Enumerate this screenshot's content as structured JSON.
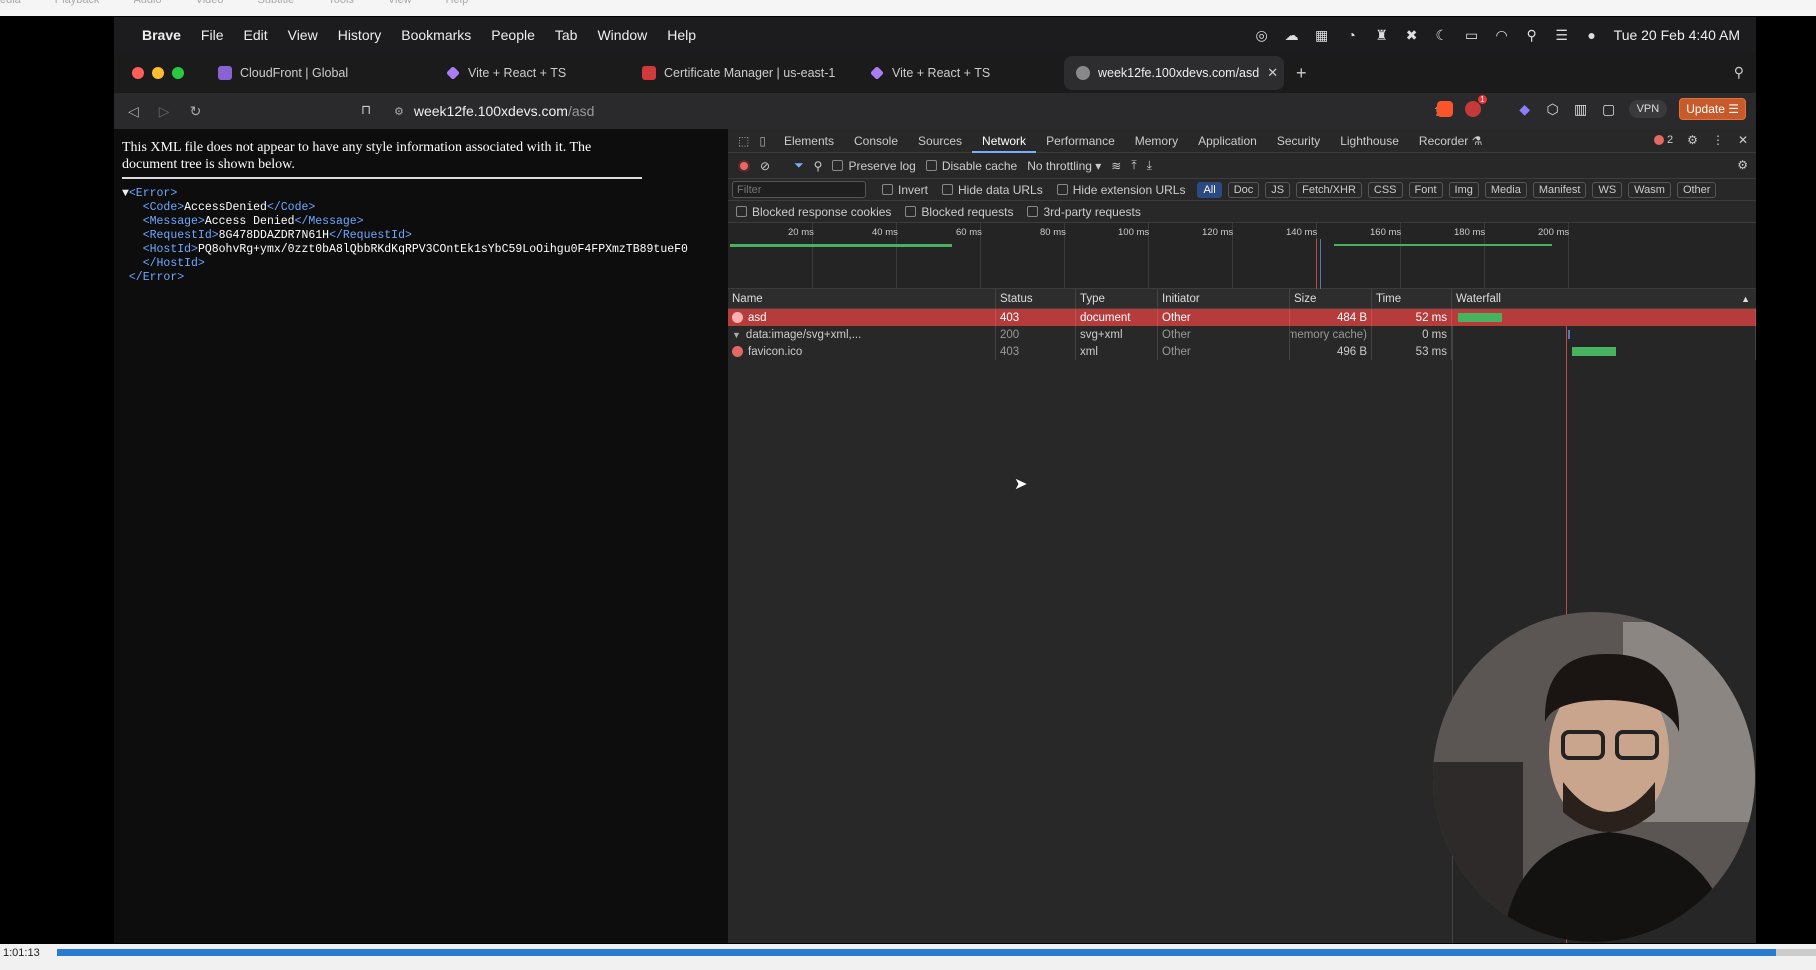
{
  "vlc_menu": [
    "edia",
    "Playback",
    "Audio",
    "Video",
    "Subtitle",
    "Tools",
    "View",
    "Help"
  ],
  "mac_menu": {
    "apple": "",
    "items": [
      "Brave",
      "File",
      "Edit",
      "View",
      "History",
      "Bookmarks",
      "People",
      "Tab",
      "Window",
      "Help"
    ],
    "clock": "Tue 20 Feb  4:40 AM"
  },
  "tabs": [
    {
      "title": "CloudFront | Global",
      "favicon_color": "#8a63d2"
    },
    {
      "title": "Vite + React + TS",
      "favicon_color": "#a97cf8"
    },
    {
      "title": "Certificate Manager | us-east-1",
      "favicon_color": "#d13a3a"
    },
    {
      "title": "Vite + React + TS",
      "favicon_color": "#a97cf8"
    },
    {
      "title": "week12fe.100xdevs.com/asd",
      "favicon_color": "#888888",
      "active": true
    }
  ],
  "toolbar": {
    "url_host": "week12fe.100xdevs.com",
    "url_path": "/asd",
    "vpn": "VPN",
    "update": "Update",
    "notif_count": "1"
  },
  "page": {
    "notice": "This XML file does not appear to have any style information associated with it. The document tree is shown below.",
    "xml": {
      "error_open": "<Error>",
      "error_close": "</Error>",
      "code_open": "<Code>",
      "code": "AccessDenied",
      "code_close": "</Code>",
      "msg_open": "<Message>",
      "message": "Access Denied",
      "msg_close": "</Message>",
      "req_open": "<RequestId>",
      "request_id": "8G478DDAZDR7N61H",
      "req_close": "</RequestId>",
      "host_open": "<HostId>",
      "host_id": "PQ8ohvRg+ymx/0zzt0bA8lQbbRKdKqRPV3COntEk1sYbC59LoOihgu0F4FPXmzTB89tueF0",
      "host_close": "</HostId>"
    }
  },
  "devtools": {
    "tabs": [
      "Elements",
      "Console",
      "Sources",
      "Network",
      "Performance",
      "Memory",
      "Application",
      "Security",
      "Lighthouse",
      "Recorder"
    ],
    "active_tab": "Network",
    "error_count": "2",
    "preserve_log": "Preserve log",
    "disable_cache": "Disable cache",
    "throttling": "No throttling",
    "filter_placeholder": "Filter",
    "invert": "Invert",
    "hide_data_urls": "Hide data URLs",
    "hide_ext_urls": "Hide extension URLs",
    "type_filters": [
      "All",
      "Doc",
      "JS",
      "Fetch/XHR",
      "CSS",
      "Font",
      "Img",
      "Media",
      "Manifest",
      "WS",
      "Wasm",
      "Other"
    ],
    "blocked_cookies": "Blocked response cookies",
    "blocked_requests": "Blocked requests",
    "third_party": "3rd-party requests",
    "timeline_ticks": [
      "20 ms",
      "40 ms",
      "60 ms",
      "80 ms",
      "100 ms",
      "120 ms",
      "140 ms",
      "160 ms",
      "180 ms",
      "200 ms"
    ],
    "columns": [
      "Name",
      "Status",
      "Type",
      "Initiator",
      "Size",
      "Time",
      "Waterfall"
    ],
    "rows": [
      {
        "name": "asd",
        "status": "403",
        "type": "document",
        "initiator": "Other",
        "size": "484 B",
        "time": "52 ms",
        "error": true
      },
      {
        "name": "data:image/svg+xml,...",
        "status": "200",
        "type": "svg+xml",
        "initiator": "Other",
        "size": "(memory cache)",
        "time": "0 ms",
        "error": false
      },
      {
        "name": "favicon.ico",
        "status": "403",
        "type": "xml",
        "initiator": "Other",
        "size": "496 B",
        "time": "53 ms",
        "error": true
      }
    ]
  },
  "player": {
    "timecode": "1:01:13",
    "progress": 0.977
  }
}
